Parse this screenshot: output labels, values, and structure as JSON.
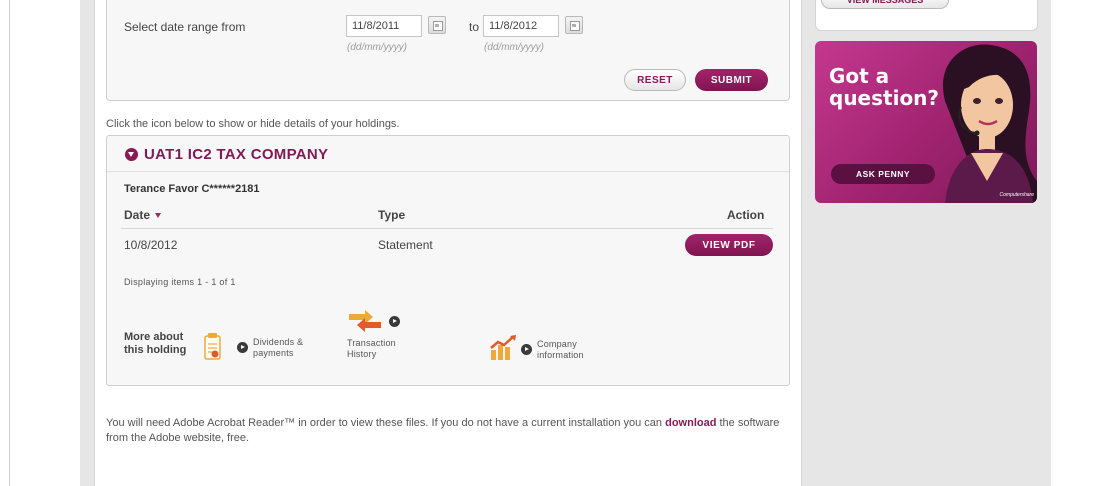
{
  "filter": {
    "label": "Select date range from",
    "from_value": "11/8/2011",
    "to_label": "to",
    "to_value": "11/8/2012",
    "format_hint": "(dd/mm/yyyy)",
    "reset_label": "RESET",
    "submit_label": "SUBMIT"
  },
  "instructions": "Click the icon below to show or hide details of your holdings.",
  "holding": {
    "company": "UAT1 IC2 TAX COMPANY",
    "holder": "Terance Favor C******2181",
    "columns": {
      "date": "Date",
      "type": "Type",
      "action": "Action"
    },
    "rows": [
      {
        "date": "10/8/2012",
        "type": "Statement",
        "action": "VIEW PDF"
      }
    ],
    "display_count": "Displaying items 1 - 1 of 1",
    "more_label": "More about this holding",
    "links": [
      {
        "label1": "Dividends &",
        "label2": "payments",
        "icon": "document-icon"
      },
      {
        "label1": "Transaction",
        "label2": "History",
        "icon": "exchange-arrows-icon"
      },
      {
        "label1": "Company",
        "label2": "information",
        "icon": "bar-chart-icon"
      }
    ]
  },
  "footer": {
    "text_before": "You will need Adobe Acrobat Reader™ in order to view these files. If you do not have a current installation you can ",
    "link_text": "download",
    "text_after": " the software from the Adobe website, free."
  },
  "sidebar": {
    "top_button": "VIEW MESSAGES",
    "banner_title_1": "Got a",
    "banner_title_2": "question?",
    "ask_button": "ASK PENNY",
    "brand": "Computershare"
  },
  "colors": {
    "accent": "#8a1a56",
    "banner": "#a0236f",
    "panel_bg": "#f7f7f7",
    "page_bg": "#e6e6e6"
  }
}
